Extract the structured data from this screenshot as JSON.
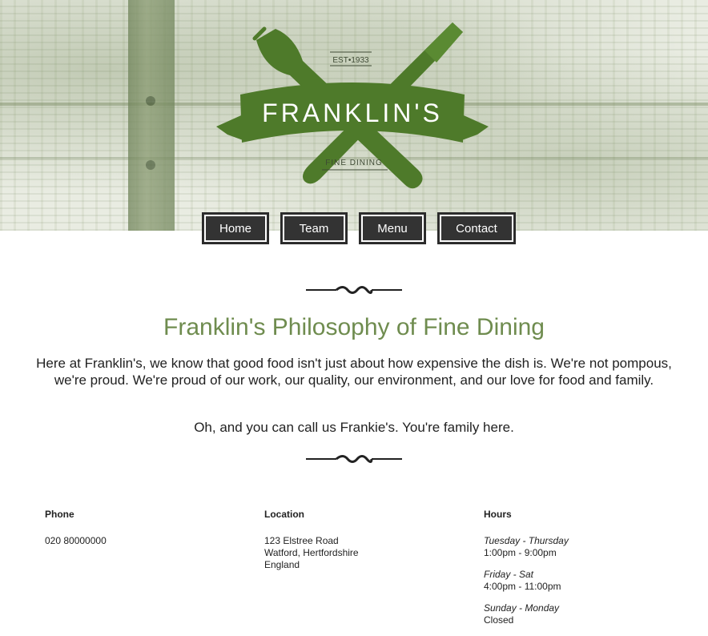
{
  "brand": {
    "name": "FRANKLIN'S",
    "established": "EST•1933",
    "tagline": "FINE DINING",
    "accent_color": "#4e7a2a"
  },
  "nav": {
    "items": [
      {
        "label": "Home"
      },
      {
        "label": "Team"
      },
      {
        "label": "Menu"
      },
      {
        "label": "Contact"
      }
    ]
  },
  "main": {
    "title": "Franklin's Philosophy of Fine Dining",
    "intro": "Here at Franklin's, we know that good food isn't just about how expensive the dish is. We're not pompous, we're proud. We're proud of our work, our quality, our environment, and our love for food and family.",
    "family_note": "Oh, and you can call us Frankie's. You're family here.",
    "title_color": "#6f8c4f"
  },
  "footer": {
    "phone": {
      "heading": "Phone",
      "value": "020 80000000"
    },
    "location": {
      "heading": "Location",
      "line1": "123 Elstree Road",
      "line2": "Watford, Hertfordshire",
      "line3": "England"
    },
    "hours": {
      "heading": "Hours",
      "blocks": [
        {
          "days": "Tuesday - Thursday",
          "time": "1:00pm - 9:00pm"
        },
        {
          "days": "Friday - Sat",
          "time": "4:00pm - 11:00pm"
        },
        {
          "days": "Sunday - Monday",
          "time": "Closed"
        }
      ]
    }
  },
  "icons": [
    "fork-icon",
    "knife-icon",
    "ornament-divider-icon"
  ]
}
